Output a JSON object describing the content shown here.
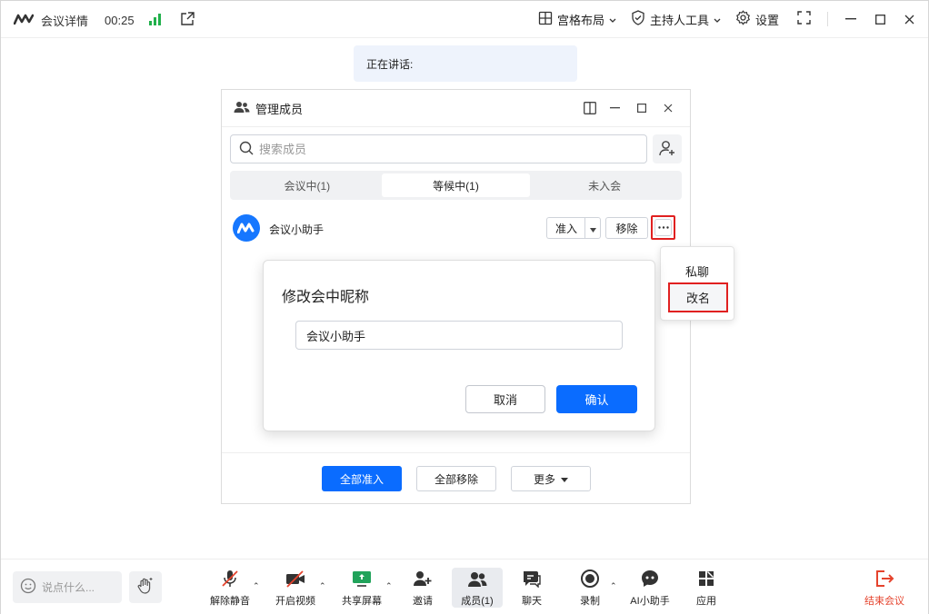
{
  "app": {
    "meeting_info": "会议详情",
    "timer": "00:25"
  },
  "toolbar_top": {
    "layout": "宫格布局",
    "host_tools": "主持人工具",
    "settings": "设置"
  },
  "speaking_banner": "正在讲话:",
  "panel": {
    "title": "管理成员",
    "search_placeholder": "搜索成员",
    "tabs": [
      {
        "label": "会议中(1)",
        "active": false
      },
      {
        "label": "等候中(1)",
        "active": true
      },
      {
        "label": "未入会",
        "active": false
      }
    ],
    "member": {
      "name": "会议小助手",
      "admit": "准入",
      "remove": "移除"
    },
    "footer": {
      "admit_all": "全部准入",
      "remove_all": "全部移除",
      "more": "更多"
    }
  },
  "context_menu": {
    "private_chat": "私聊",
    "rename": "改名"
  },
  "rename_dialog": {
    "title": "修改会中昵称",
    "value": "会议小助手",
    "cancel": "取消",
    "confirm": "确认"
  },
  "bottombar": {
    "chat_placeholder": "说点什么...",
    "tools": [
      {
        "label": "解除静音",
        "icon": "mic-off-icon"
      },
      {
        "label": "开启视频",
        "icon": "camera-off-icon"
      },
      {
        "label": "共享屏幕",
        "icon": "share-screen-icon"
      },
      {
        "label": "邀请",
        "icon": "invite-icon"
      },
      {
        "label": "成员(1)",
        "icon": "members-icon"
      },
      {
        "label": "聊天",
        "icon": "chat-icon"
      },
      {
        "label": "录制",
        "icon": "record-icon"
      },
      {
        "label": "AI小助手",
        "icon": "ai-assistant-icon"
      },
      {
        "label": "应用",
        "icon": "apps-icon"
      }
    ],
    "end_meeting": "结束会议"
  },
  "colors": {
    "primary": "#0a6cff",
    "danger": "#e5432d",
    "highlight_box": "#e02020",
    "signal": "#21b04b"
  }
}
